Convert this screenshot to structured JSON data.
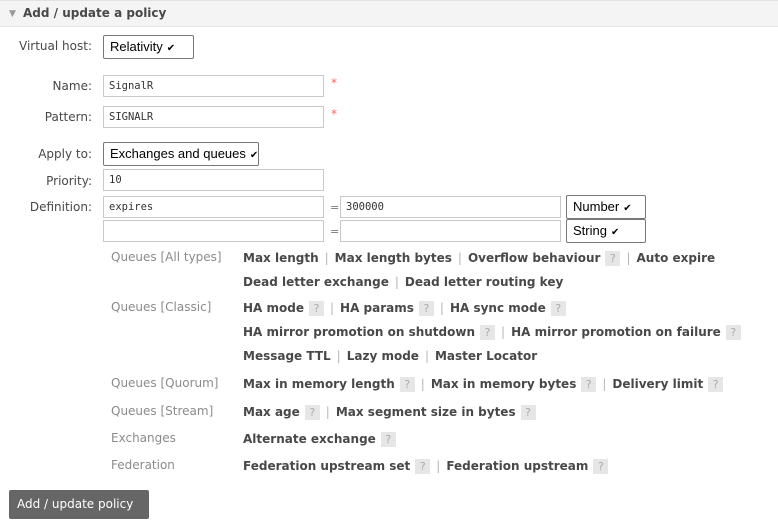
{
  "header": {
    "title": "Add / update a policy"
  },
  "form": {
    "vhost": {
      "label": "Virtual host:",
      "value": "Relativity"
    },
    "name": {
      "label": "Name:",
      "value": "SignalR",
      "required": "*"
    },
    "pattern": {
      "label": "Pattern:",
      "value": "SIGNALR",
      "required": "*"
    },
    "apply_to": {
      "label": "Apply to:",
      "value": "Exchanges and queues"
    },
    "priority": {
      "label": "Priority:",
      "value": "10"
    },
    "definition": {
      "label": "Definition:",
      "rows": [
        {
          "key": "expires",
          "eq": "=",
          "value": "300000",
          "type": "Number"
        },
        {
          "key": "",
          "eq": "=",
          "value": "",
          "type": "String"
        }
      ]
    }
  },
  "help": {
    "q": "?",
    "sep": "|"
  },
  "categories": {
    "all": {
      "label": "Queues [All types]",
      "line1": [
        "Max length",
        "Max length bytes",
        "Overflow behaviour",
        "Auto expire"
      ],
      "line2": [
        "Dead letter exchange",
        "Dead letter routing key"
      ]
    },
    "classic": {
      "label": "Queues [Classic]",
      "line1": [
        "HA mode",
        "HA params",
        "HA sync mode"
      ],
      "line2": [
        "HA mirror promotion on shutdown",
        "HA mirror promotion on failure"
      ],
      "line3": [
        "Message TTL",
        "Lazy mode",
        "Master Locator"
      ]
    },
    "quorum": {
      "label": "Queues [Quorum]",
      "line1": [
        "Max in memory length",
        "Max in memory bytes",
        "Delivery limit"
      ]
    },
    "stream": {
      "label": "Queues [Stream]",
      "line1": [
        "Max age",
        "Max segment size in bytes"
      ]
    },
    "exchanges": {
      "label": "Exchanges",
      "line1": [
        "Alternate exchange"
      ]
    },
    "federation": {
      "label": "Federation",
      "line1": [
        "Federation upstream set",
        "Federation upstream"
      ]
    }
  },
  "submit": {
    "label": "Add / update policy"
  },
  "icons": {
    "collapse": "triangle-down-icon",
    "dropdown": "chevron-down-icon"
  }
}
